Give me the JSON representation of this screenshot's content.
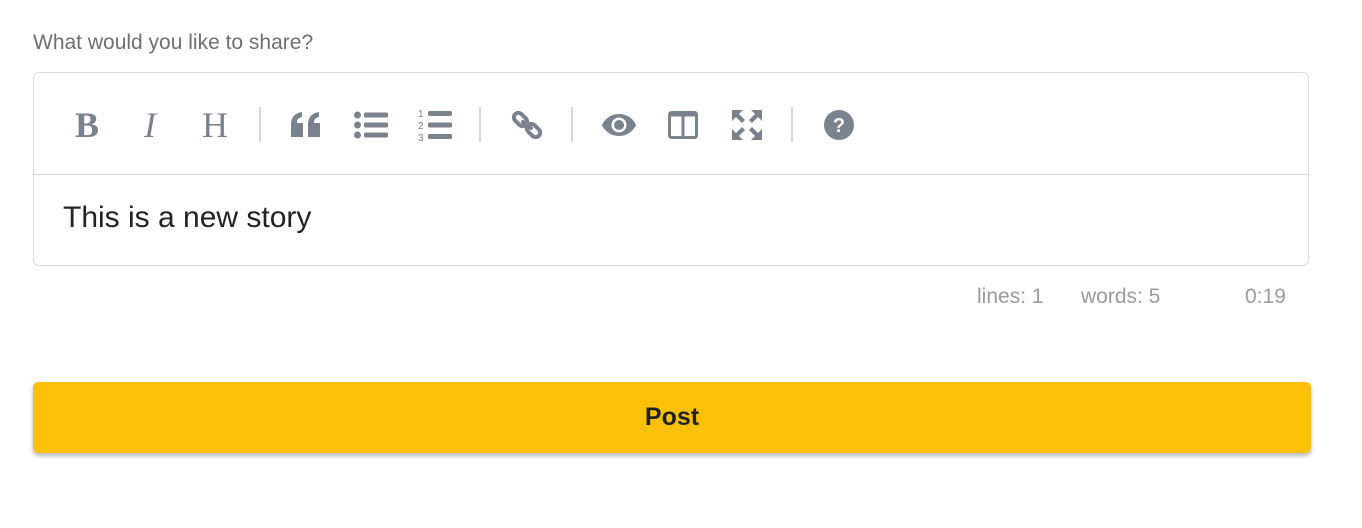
{
  "form": {
    "label": "What would you like to share?"
  },
  "editor": {
    "toolbar": [
      {
        "name": "bold-button",
        "icon": "bold-icon"
      },
      {
        "name": "italic-button",
        "icon": "italic-icon"
      },
      {
        "name": "heading-button",
        "icon": "heading-icon"
      },
      {
        "name": "quote-button",
        "icon": "quote-icon"
      },
      {
        "name": "unordered-list-button",
        "icon": "unordered-list-icon"
      },
      {
        "name": "ordered-list-button",
        "icon": "ordered-list-icon"
      },
      {
        "name": "link-button",
        "icon": "link-icon"
      },
      {
        "name": "preview-button",
        "icon": "eye-icon"
      },
      {
        "name": "side-by-side-button",
        "icon": "columns-icon"
      },
      {
        "name": "fullscreen-button",
        "icon": "expand-icon"
      },
      {
        "name": "guide-button",
        "icon": "question-circle-icon"
      }
    ],
    "content": "This is a new story",
    "icon_color": "#7a838d"
  },
  "statusbar": {
    "lines": "lines: 1",
    "words": "words: 5",
    "cursor": "0:19"
  },
  "submit": {
    "label": "Post",
    "color": "#fdc009"
  }
}
